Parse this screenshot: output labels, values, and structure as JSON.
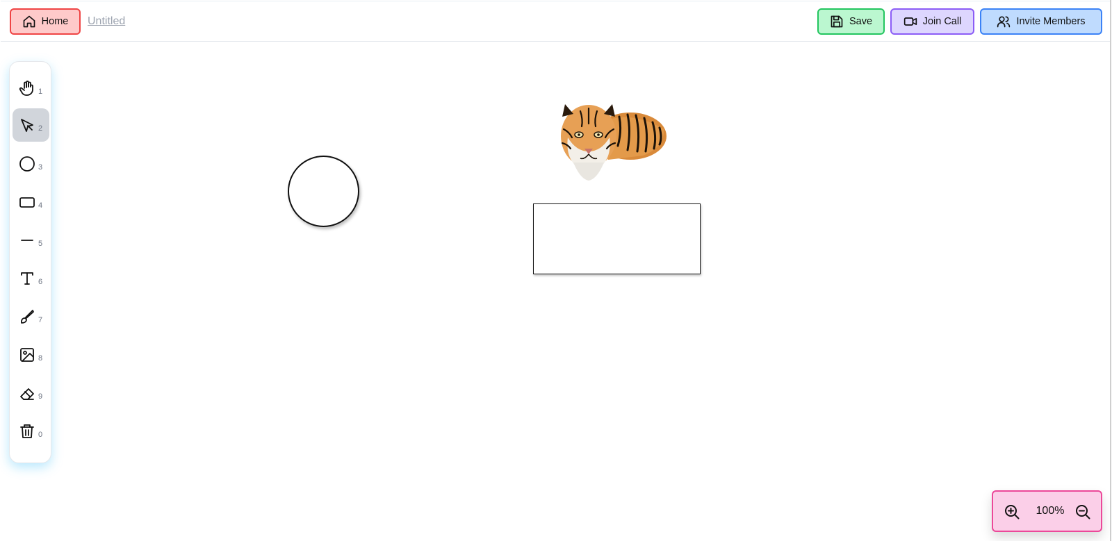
{
  "header": {
    "home_label": "Home",
    "doc_title": "Untitled",
    "save_label": "Save",
    "join_call_label": "Join Call",
    "invite_label": "Invite Members"
  },
  "toolbar": {
    "tools": [
      {
        "icon": "hand-icon",
        "shortcut": "1",
        "active": false
      },
      {
        "icon": "pointer-icon",
        "shortcut": "2",
        "active": true
      },
      {
        "icon": "circle-icon",
        "shortcut": "3",
        "active": false
      },
      {
        "icon": "rectangle-icon",
        "shortcut": "4",
        "active": false
      },
      {
        "icon": "line-icon",
        "shortcut": "5",
        "active": false
      },
      {
        "icon": "text-icon",
        "shortcut": "6",
        "active": false
      },
      {
        "icon": "brush-icon",
        "shortcut": "7",
        "active": false
      },
      {
        "icon": "image-icon",
        "shortcut": "8",
        "active": false
      },
      {
        "icon": "eraser-icon",
        "shortcut": "9",
        "active": false
      },
      {
        "icon": "trash-icon",
        "shortcut": "0",
        "active": false
      }
    ]
  },
  "canvas": {
    "items": [
      "circle-shape",
      "rectangle-shape",
      "tiger-image"
    ]
  },
  "zoom": {
    "value": "100%"
  },
  "colors": {
    "home": "#fecaca",
    "save": "#bbf7d0",
    "call": "#ddd6fe",
    "invite": "#bfdbfe",
    "zoom": "#fbcfe8",
    "active_tool": "#d1d5db"
  }
}
